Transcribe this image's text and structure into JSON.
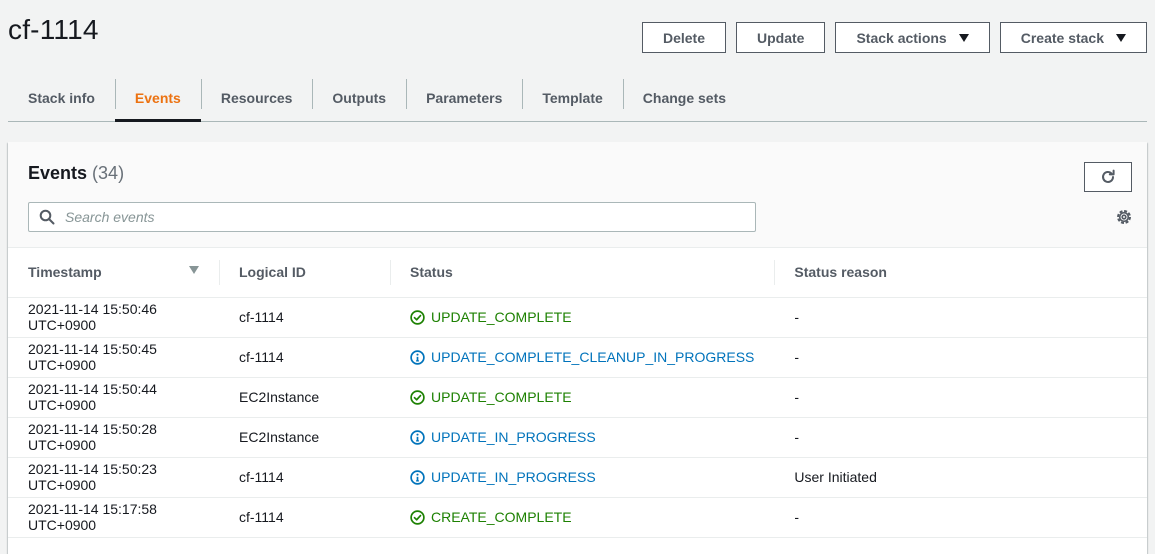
{
  "header": {
    "title": "cf-1114",
    "buttons": {
      "delete": "Delete",
      "update": "Update",
      "stack_actions": "Stack actions",
      "create_stack": "Create stack"
    }
  },
  "tabs": [
    {
      "label": "Stack info",
      "active": false
    },
    {
      "label": "Events",
      "active": true
    },
    {
      "label": "Resources",
      "active": false
    },
    {
      "label": "Outputs",
      "active": false
    },
    {
      "label": "Parameters",
      "active": false
    },
    {
      "label": "Template",
      "active": false
    },
    {
      "label": "Change sets",
      "active": false
    }
  ],
  "events": {
    "title": "Events",
    "count": "(34)",
    "search_placeholder": "Search events",
    "columns": [
      "Timestamp",
      "Logical ID",
      "Status",
      "Status reason"
    ],
    "rows": [
      {
        "timestamp": "2021-11-14 15:50:46 UTC+0900",
        "logical_id": "cf-1114",
        "status": "UPDATE_COMPLETE",
        "status_type": "ok",
        "reason": "-"
      },
      {
        "timestamp": "2021-11-14 15:50:45 UTC+0900",
        "logical_id": "cf-1114",
        "status": "UPDATE_COMPLETE_CLEANUP_IN_PROGRESS",
        "status_type": "info",
        "reason": "-"
      },
      {
        "timestamp": "2021-11-14 15:50:44 UTC+0900",
        "logical_id": "EC2Instance",
        "status": "UPDATE_COMPLETE",
        "status_type": "ok",
        "reason": "-"
      },
      {
        "timestamp": "2021-11-14 15:50:28 UTC+0900",
        "logical_id": "EC2Instance",
        "status": "UPDATE_IN_PROGRESS",
        "status_type": "info",
        "reason": "-"
      },
      {
        "timestamp": "2021-11-14 15:50:23 UTC+0900",
        "logical_id": "cf-1114",
        "status": "UPDATE_IN_PROGRESS",
        "status_type": "info",
        "reason": "User Initiated"
      },
      {
        "timestamp": "2021-11-14 15:17:58 UTC+0900",
        "logical_id": "cf-1114",
        "status": "CREATE_COMPLETE",
        "status_type": "ok",
        "reason": "-"
      }
    ]
  },
  "colors": {
    "active_tab": "#ec7211",
    "status_ok": "#1d8102",
    "status_info": "#0073bb"
  },
  "icons": {
    "sort": "caret-down-icon",
    "refresh": "refresh-icon",
    "search": "search-icon",
    "settings": "gear-icon",
    "ok": "check-circle-icon",
    "info": "info-circle-icon"
  }
}
